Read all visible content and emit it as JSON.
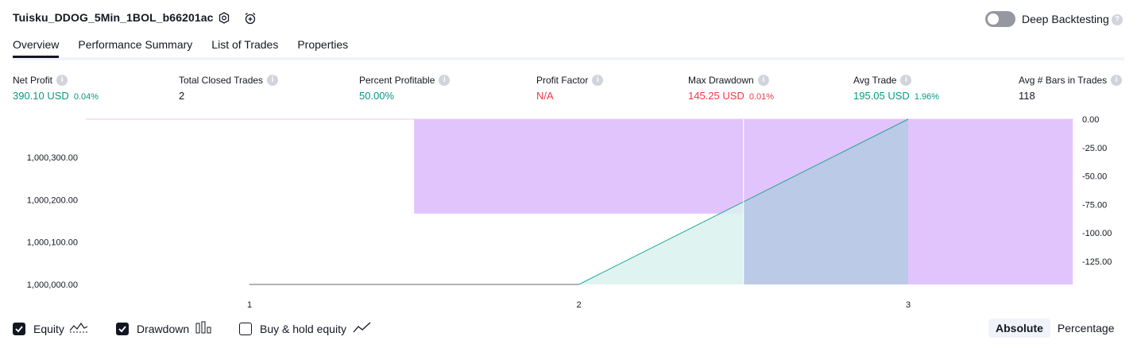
{
  "header": {
    "title": "Tuisku_DDOG_5Min_1BOL_b66201ac",
    "deep_backtesting_label": "Deep Backtesting",
    "deep_backtesting_on": false
  },
  "tabs": [
    {
      "label": "Overview",
      "active": true
    },
    {
      "label": "Performance Summary",
      "active": false
    },
    {
      "label": "List of Trades",
      "active": false
    },
    {
      "label": "Properties",
      "active": false
    }
  ],
  "metrics": {
    "net_profit": {
      "label": "Net Profit",
      "value": "390.10 USD",
      "pct": "0.04%"
    },
    "total_closed_trades": {
      "label": "Total Closed Trades",
      "value": "2"
    },
    "percent_profitable": {
      "label": "Percent Profitable",
      "value": "50.00%"
    },
    "profit_factor": {
      "label": "Profit Factor",
      "value": "N/A"
    },
    "max_drawdown": {
      "label": "Max Drawdown",
      "value": "145.25 USD",
      "pct": "0.01%"
    },
    "avg_trade": {
      "label": "Avg Trade",
      "value": "195.05 USD",
      "pct": "1.96%"
    },
    "avg_bars": {
      "label": "Avg # Bars in Trades",
      "value": "118"
    }
  },
  "chart_data": {
    "type": "area",
    "x_ticks": [
      "1",
      "2",
      "3"
    ],
    "equity": {
      "x": [
        1,
        2,
        3
      ],
      "y": [
        1000000.0,
        1000000.0,
        1000390.1
      ]
    },
    "drawdown_bars": [
      {
        "from": 1.5,
        "to": 2.5,
        "value": -83.0
      },
      {
        "from": 2.5,
        "to": 3.5,
        "value": -145.25
      }
    ],
    "left_axis": {
      "ticks": [
        "1,000,000.00",
        "1,000,100.00",
        "1,000,200.00",
        "1,000,300.00"
      ],
      "values": [
        1000000,
        1000100,
        1000200,
        1000300
      ],
      "range": [
        1000000,
        1000390.1
      ]
    },
    "right_axis": {
      "ticks": [
        "0.00",
        "-25.00",
        "-50.00",
        "-75.00",
        "-100.00",
        "-125.00"
      ],
      "values": [
        0,
        -25,
        -50,
        -75,
        -100,
        -125
      ],
      "range": [
        -145.25,
        0
      ]
    },
    "colors": {
      "equity_line": "#26a69a",
      "equity_fill": "#d9f2ee",
      "drawdown": "#e1c4fc",
      "baseline": "#9598a1"
    }
  },
  "legend": {
    "equity": {
      "label": "Equity",
      "checked": true
    },
    "drawdown": {
      "label": "Drawdown",
      "checked": true
    },
    "buy_hold": {
      "label": "Buy & hold equity",
      "checked": false
    }
  },
  "mode": {
    "absolute": "Absolute",
    "percentage": "Percentage",
    "selected": "Absolute"
  }
}
